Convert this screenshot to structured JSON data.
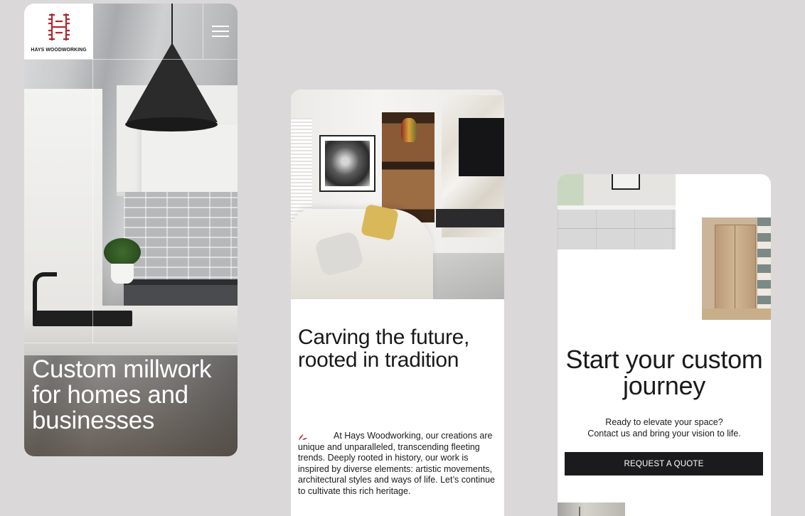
{
  "brand": {
    "name": "HAYS WOODWORKING",
    "accent_color": "#b3262e"
  },
  "screen_hero": {
    "menu_icon": "hamburger-menu-icon",
    "headline": "Custom millwork for homes and businesses"
  },
  "screen_about": {
    "headline": "Carving the future, rooted in tradition",
    "body": "At Hays Woodworking, our creations are unique and unparalleled, transcending fleeting trends. Deeply rooted in history, our work is inspired by diverse elements: artistic movements, architectural styles and ways of life. Let’s continue to cultivate this rich heritage."
  },
  "screen_cta": {
    "headline": "Start your custom journey",
    "subtext_line1": "Ready to elevate your space?",
    "subtext_line2": "Contact us and bring your vision to life.",
    "button_label": "REQUEST A QUOTE"
  }
}
